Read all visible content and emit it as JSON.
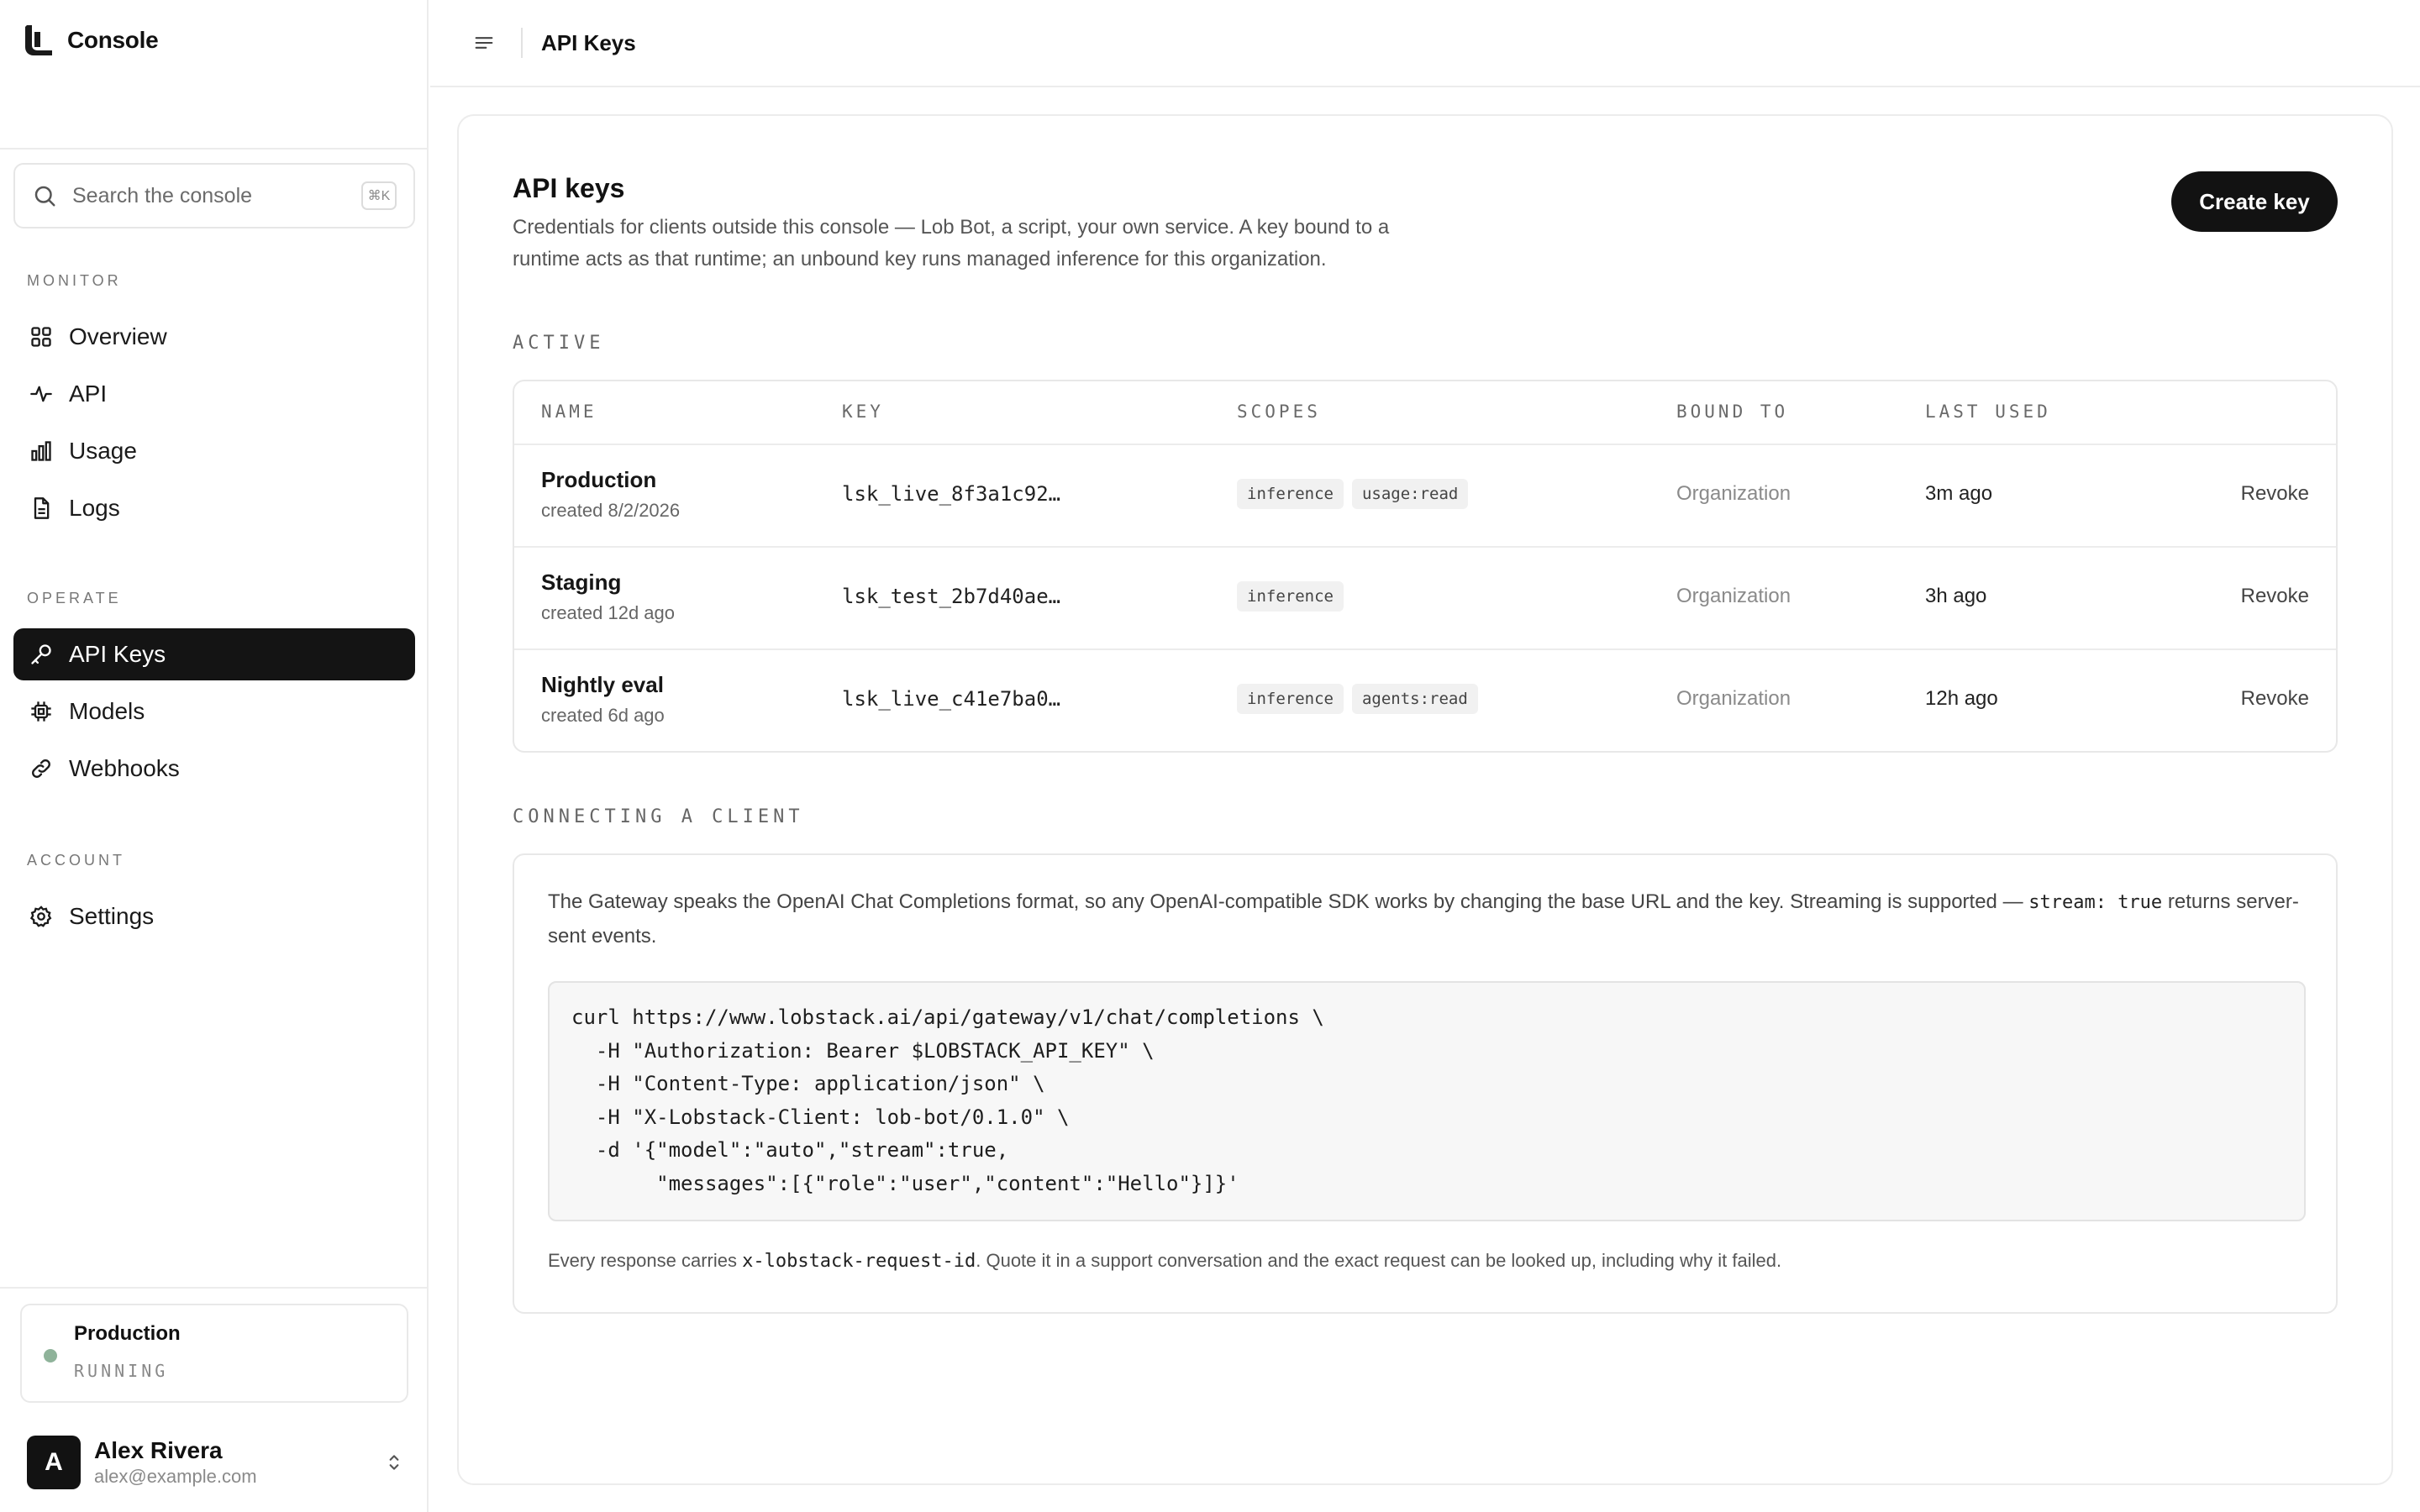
{
  "app": {
    "name": "Console"
  },
  "search": {
    "placeholder": "Search the console",
    "shortcut": "⌘K"
  },
  "nav": {
    "sections": [
      {
        "label": "MONITOR",
        "items": [
          {
            "label": "Overview",
            "icon": "grid-icon"
          },
          {
            "label": "API",
            "icon": "activity-icon"
          },
          {
            "label": "Usage",
            "icon": "bar-chart-icon"
          },
          {
            "label": "Logs",
            "icon": "document-icon"
          }
        ]
      },
      {
        "label": "OPERATE",
        "items": [
          {
            "label": "API Keys",
            "icon": "key-icon",
            "active": true
          },
          {
            "label": "Models",
            "icon": "chip-icon"
          },
          {
            "label": "Webhooks",
            "icon": "link-icon"
          }
        ]
      },
      {
        "label": "ACCOUNT",
        "items": [
          {
            "label": "Settings",
            "icon": "gear-icon"
          }
        ]
      }
    ]
  },
  "runtime": {
    "name": "Production",
    "status": "RUNNING",
    "status_color": "#8fb39a"
  },
  "user": {
    "initial": "A",
    "name": "Alex Rivera",
    "email": "alex@example.com"
  },
  "topbar": {
    "title": "API Keys"
  },
  "page": {
    "title": "API keys",
    "description": "Credentials for clients outside this console — Lob Bot, a script, your own service. A key bound to a runtime acts as that runtime; an unbound key runs managed inference for this organization.",
    "create_button": "Create key"
  },
  "active": {
    "label": "ACTIVE",
    "columns": [
      "NAME",
      "KEY",
      "SCOPES",
      "BOUND TO",
      "LAST USED"
    ],
    "rows": [
      {
        "name": "Production",
        "created": "created 8/2/2026",
        "key": "lsk_live_8f3a1c92…",
        "scopes": [
          "inference",
          "usage:read"
        ],
        "bound_to": "Organization",
        "last_used": "3m ago",
        "action": "Revoke"
      },
      {
        "name": "Staging",
        "created": "created 12d ago",
        "key": "lsk_test_2b7d40ae…",
        "scopes": [
          "inference"
        ],
        "bound_to": "Organization",
        "last_used": "3h ago",
        "action": "Revoke"
      },
      {
        "name": "Nightly eval",
        "created": "created 6d ago",
        "key": "lsk_live_c41e7ba0…",
        "scopes": [
          "inference",
          "agents:read"
        ],
        "bound_to": "Organization",
        "last_used": "12h ago",
        "action": "Revoke"
      }
    ]
  },
  "connect": {
    "label": "CONNECTING A CLIENT",
    "text_before": "The Gateway speaks the OpenAI Chat Completions format, so any OpenAI-compatible SDK works by changing the base URL and the key. Streaming is supported — ",
    "text_code": "stream: true",
    "text_after": " returns server-sent events.",
    "code": "curl https://www.lobstack.ai/api/gateway/v1/chat/completions \\\n  -H \"Authorization: Bearer $LOBSTACK_API_KEY\" \\\n  -H \"Content-Type: application/json\" \\\n  -H \"X-Lobstack-Client: lob-bot/0.1.0\" \\\n  -d '{\"model\":\"auto\",\"stream\":true,\n       \"messages\":[{\"role\":\"user\",\"content\":\"Hello\"}]}'",
    "note_before": "Every response carries ",
    "note_code": "x-lobstack-request-id",
    "note_after": ". Quote it in a support conversation and the exact request can be looked up, including why it failed."
  }
}
